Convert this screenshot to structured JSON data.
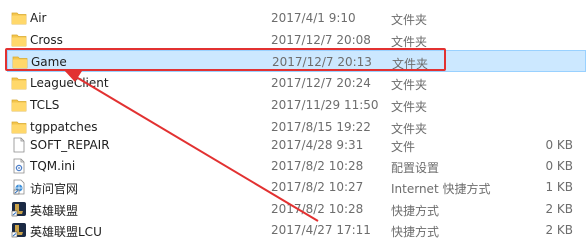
{
  "files": [
    {
      "name": "Air",
      "date": "2017/4/1 9:10",
      "type": "文件夹",
      "size": "",
      "icon": "folder-icon"
    },
    {
      "name": "Cross",
      "date": "2017/12/7 20:08",
      "type": "文件夹",
      "size": "",
      "icon": "folder-icon"
    },
    {
      "name": "Game",
      "date": "2017/12/7 20:13",
      "type": "文件夹",
      "size": "",
      "icon": "folder-icon",
      "selected": true
    },
    {
      "name": "LeagueClient",
      "date": "2017/12/7 20:24",
      "type": "文件夹",
      "size": "",
      "icon": "folder-icon"
    },
    {
      "name": "TCLS",
      "date": "2017/11/29 11:50",
      "type": "文件夹",
      "size": "",
      "icon": "folder-icon"
    },
    {
      "name": "tgppatches",
      "date": "2017/8/15 19:22",
      "type": "文件夹",
      "size": "",
      "icon": "folder-icon"
    },
    {
      "name": "SOFT_REPAIR",
      "date": "2017/4/28 9:31",
      "type": "文件",
      "size": "0 KB",
      "icon": "blank-file-icon"
    },
    {
      "name": "TQM.ini",
      "date": "2017/8/2 10:28",
      "type": "配置设置",
      "size": "0 KB",
      "icon": "ini-file-icon"
    },
    {
      "name": "访问官网",
      "date": "2017/8/2 10:27",
      "type": "Internet 快捷方式",
      "size": "1 KB",
      "icon": "internet-shortcut-icon"
    },
    {
      "name": "英雄联盟",
      "date": "2017/8/2 10:28",
      "type": "快捷方式",
      "size": "2 KB",
      "icon": "game-shortcut-icon"
    },
    {
      "name": "英雄联盟LCU",
      "date": "2017/4/27 17:11",
      "type": "快捷方式",
      "size": "2 KB",
      "icon": "game-shortcut-icon"
    }
  ],
  "colors": {
    "folder": "#f3c54e",
    "selection_bg": "#cce8ff",
    "selection_border": "#99d1ff",
    "annotation": "#e23131"
  }
}
